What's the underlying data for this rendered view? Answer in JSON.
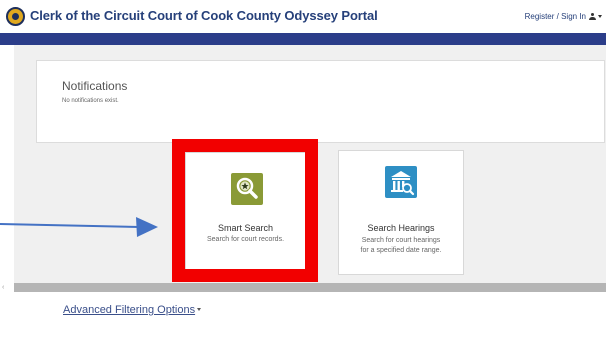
{
  "header": {
    "title": "Clerk of the Circuit Court of Cook County Odyssey Portal",
    "signin_label": "Register / Sign In",
    "logo_icon": "county-seal-logo"
  },
  "notifications": {
    "title": "Notifications",
    "message": "No notifications exist."
  },
  "tiles": [
    {
      "id": "smart-search",
      "label": "Smart Search",
      "description": "Search for court records.",
      "icon": "magnifier-icon",
      "icon_color": "#8a9a36",
      "highlighted": true
    },
    {
      "id": "search-hearings",
      "label": "Search Hearings",
      "description_line1": "Search for court hearings",
      "description_line2": "for a specified date range.",
      "icon": "courthouse-search-icon",
      "icon_color": "#2e8fc4"
    }
  ],
  "filtering": {
    "label": "Advanced Filtering Options"
  },
  "colors": {
    "header_text": "#26407a",
    "nav_band": "#2b3d89",
    "highlight": "#f20000",
    "annotation_arrow": "#4472c4"
  }
}
